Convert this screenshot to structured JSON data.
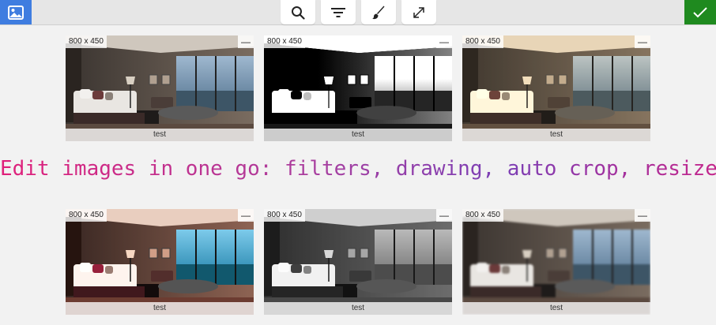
{
  "toolbar": {
    "app_icon": "image-gallery-icon",
    "tools": [
      {
        "name": "search-icon"
      },
      {
        "name": "filter-icon"
      },
      {
        "name": "brush-icon"
      },
      {
        "name": "expand-icon"
      }
    ],
    "confirm_icon": "checkmark-icon"
  },
  "images": [
    {
      "size": "800 x 450",
      "caption": "test",
      "remove": "—",
      "filter": "original"
    },
    {
      "size": "800 x 450",
      "caption": "test",
      "remove": "—",
      "filter": "sketch"
    },
    {
      "size": "800 x 450",
      "caption": "test",
      "remove": "—",
      "filter": "warm"
    },
    {
      "size": "800 x 450",
      "caption": "test",
      "remove": "—",
      "filter": "vivid"
    },
    {
      "size": "800 x 450",
      "caption": "test",
      "remove": "—",
      "filter": "grayscale"
    },
    {
      "size": "800 x 450",
      "caption": "test",
      "remove": "—",
      "filter": "pixelate"
    }
  ],
  "headline": "Edit images in one go: filters, drawing, auto crop, resize.",
  "colors": {
    "accent": "#3f7de0",
    "confirm": "#1f8a1f",
    "headline_start": "#e0207a",
    "headline_end": "#7b3fb5"
  }
}
